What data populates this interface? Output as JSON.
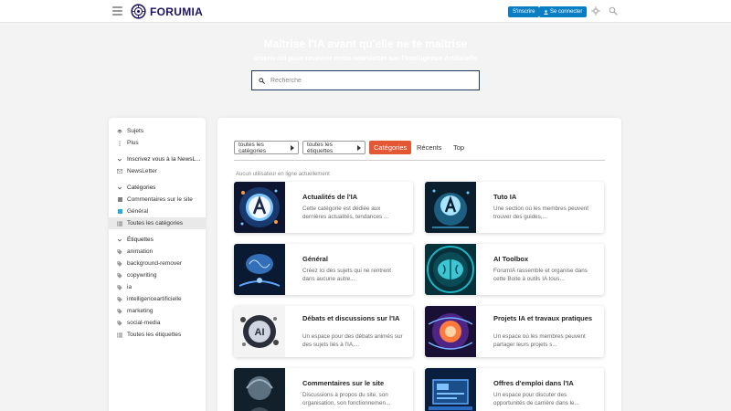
{
  "header": {
    "brand": "FORUMIA",
    "subscribe_label": "S'inscrire",
    "login_label": "Se connecter",
    "colors": {
      "accent": "#0a7ec2",
      "brand": "#1b1464"
    }
  },
  "hero": {
    "title": "Maîtrise l'IA avant qu'elle ne te maîtrise",
    "subtitle": "Inscris-toi pour recevoir notre newsletter sur l'Intelligence Artificielle",
    "search_placeholder": "Recherche"
  },
  "sidebar": {
    "top_items": [
      {
        "label": "Sujets",
        "icon": "layers-icon"
      },
      {
        "label": "Plus",
        "icon": "ellipsis-vertical-icon"
      }
    ],
    "newsletter_section": {
      "title": "Inscrivez vous à la NewsL...",
      "items": [
        {
          "label": "NewsLetter",
          "icon": "envelope-icon"
        }
      ]
    },
    "categories_section": {
      "title": "Catégories",
      "items": [
        {
          "label": "Commentaires sur le site",
          "color": "#808080"
        },
        {
          "label": "Général",
          "color": "#25aae1"
        },
        {
          "label": "Toutes les catégories",
          "icon": "list-icon"
        }
      ]
    },
    "tags_section": {
      "title": "Étiquettes",
      "items": [
        {
          "label": "animation"
        },
        {
          "label": "background-remover"
        },
        {
          "label": "copywriting"
        },
        {
          "label": "ia"
        },
        {
          "label": "intelligenceartificielle"
        },
        {
          "label": "marketing"
        },
        {
          "label": "social-media"
        },
        {
          "label": "Toutes les étiquettes",
          "icon": "list-icon"
        }
      ]
    }
  },
  "main": {
    "nav": {
      "categories_dropdown": "toutes les catégories",
      "tags_dropdown": "toutes les étiquettes",
      "active_tab": "Catégories",
      "tab_recent": "Récents",
      "tab_top": "Top",
      "active_color": "#e45735"
    },
    "online_text": "Aucun utilisateur en ligne actuellement",
    "cards": [
      {
        "title": "Actualités de l'IA",
        "desc": "Cette catégorie est dédiée aux dernières actualités, tendances ..."
      },
      {
        "title": "Tuto IA",
        "desc": "Une section où les membres peuvent trouver des guides,..."
      },
      {
        "title": "Général",
        "desc": "Créez ici des sujets qui ne rentrent dans aucune autre..."
      },
      {
        "title": "AI Toolbox",
        "desc": "ForumIA rassemble et organise dans cette Boite à outils IA tous..."
      },
      {
        "title": "Débats et discussions sur l'IA",
        "desc": "Un espace pour des débats animés sur des sujets liés à l'IA,..."
      },
      {
        "title": "Projets IA et travaux pratiques",
        "desc": "Un espace où les membres peuvent partager leurs projets s..."
      },
      {
        "title": "Commentaires sur le site",
        "desc": "Discussions à propos du site, son organisation, son fonctionnemen..."
      },
      {
        "title": "Offres d'emploi dans l'IA",
        "desc": "Un espace pour discuter des opportunités de carrière dans le..."
      }
    ]
  }
}
